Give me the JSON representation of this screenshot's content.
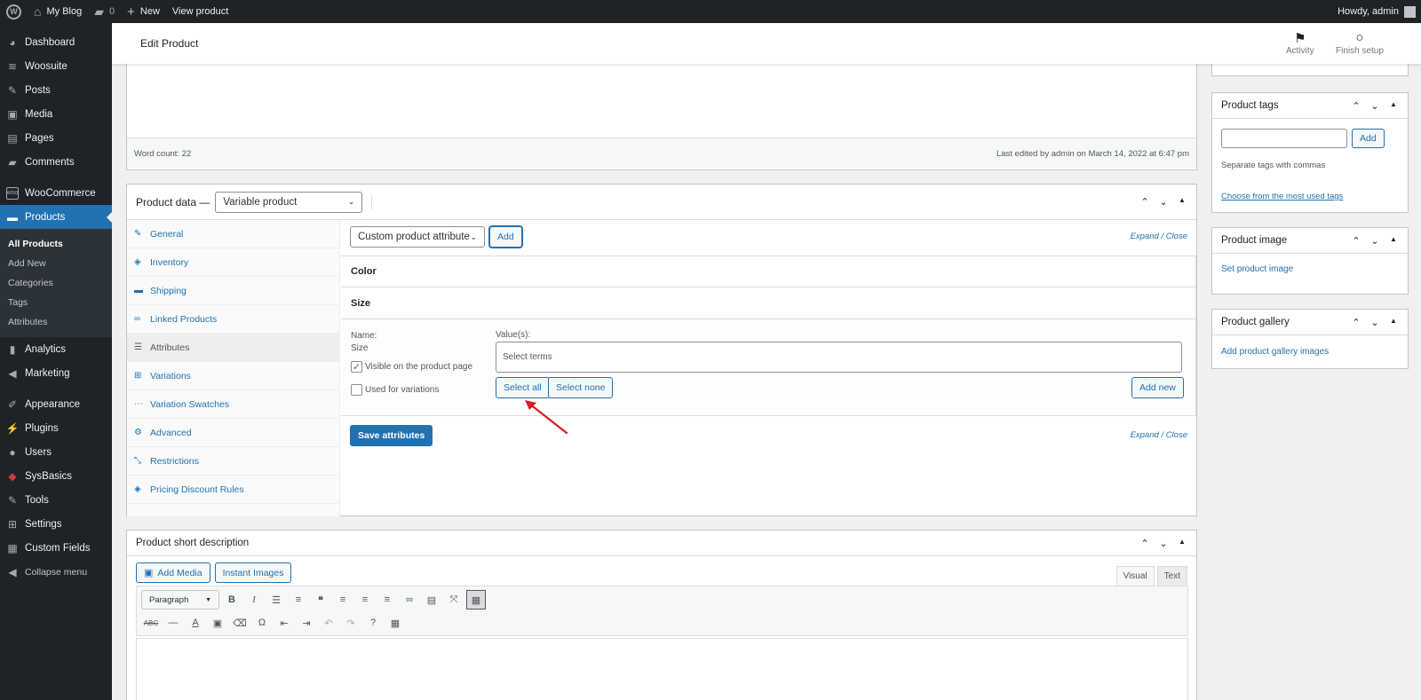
{
  "adminbar": {
    "site_name": "My Blog",
    "comments_count": "0",
    "new_label": "New",
    "view_product": "View product",
    "howdy": "Howdy, admin"
  },
  "sidebar": {
    "dashboard": "Dashboard",
    "woosuite": "Woosuite",
    "posts": "Posts",
    "media": "Media",
    "pages": "Pages",
    "comments": "Comments",
    "woocommerce": "WooCommerce",
    "products": "Products",
    "sub": {
      "all_products": "All Products",
      "add_new": "Add New",
      "categories": "Categories",
      "tags": "Tags",
      "attributes": "Attributes"
    },
    "analytics": "Analytics",
    "marketing": "Marketing",
    "appearance": "Appearance",
    "plugins": "Plugins",
    "users": "Users",
    "sysbasics": "SysBasics",
    "tools": "Tools",
    "settings": "Settings",
    "custom_fields": "Custom Fields",
    "collapse": "Collapse menu"
  },
  "header": {
    "title": "Edit Product",
    "activity": "Activity",
    "finish_setup": "Finish setup"
  },
  "editor": {
    "word_count": "Word count: 22",
    "last_edited": "Last edited by admin on March 14, 2022 at 6:47 pm"
  },
  "product_data": {
    "label": "Product data —",
    "type_select": "Variable product",
    "tabs": {
      "general": "General",
      "inventory": "Inventory",
      "shipping": "Shipping",
      "linked": "Linked Products",
      "attributes": "Attributes",
      "variations": "Variations",
      "swatches": "Variation Swatches",
      "advanced": "Advanced",
      "restrictions": "Restrictions",
      "pricing": "Pricing Discount Rules"
    },
    "attr_select": "Custom product attribute",
    "add_btn": "Add",
    "expand_close": "Expand / Close",
    "attr_color": "Color",
    "attr_size": "Size",
    "name_label": "Name:",
    "name_value": "Size",
    "values_label": "Value(s):",
    "select_terms": "Select terms",
    "visible_label": "Visible on the product page",
    "used_label": "Used for variations",
    "select_all": "Select all",
    "select_none": "Select none",
    "add_new": "Add new",
    "save_attributes": "Save attributes"
  },
  "short_desc": {
    "title": "Product short description",
    "add_media": "Add Media",
    "instant_images": "Instant Images",
    "tab_visual": "Visual",
    "tab_text": "Text",
    "paragraph": "Paragraph"
  },
  "side": {
    "tags_title": "Product tags",
    "tags_add": "Add",
    "tags_hint": "Separate tags with commas",
    "tags_choose": "Choose from the most used tags",
    "image_title": "Product image",
    "image_set": "Set product image",
    "gallery_title": "Product gallery",
    "gallery_add": "Add product gallery images"
  },
  "colors": {
    "admin_dark": "#1d2327",
    "accent": "#2271b1",
    "annotation_arrow": "#e0191e"
  }
}
